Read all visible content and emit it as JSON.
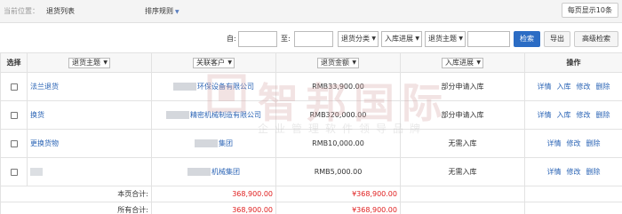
{
  "topbar": {
    "location_label": "当前位置：",
    "location_value": "退货列表",
    "sort_label": "排序规则",
    "page_size": "每页显示10条"
  },
  "filter": {
    "from_label": "自:",
    "to_label": "至:",
    "select_category": "退货分类",
    "select_stock": "入库进展",
    "select_subject": "退货主题",
    "search_button": "检索",
    "export_button": "导出",
    "advanced_button": "高级检索"
  },
  "table": {
    "headers": {
      "select": "选择",
      "subject": "退货主题",
      "customer": "关联客户",
      "amount": "退货金额",
      "stock": "入库进展",
      "ops": "操作"
    },
    "rows": [
      {
        "subject": "法兰退货",
        "customer": "环保设备有限公司",
        "amount": "RMB33,900.00",
        "stock": "部分申请入库",
        "ops": [
          "详情",
          "入库",
          "修改",
          "删除"
        ]
      },
      {
        "subject": "换货",
        "customer": "精密机械制造有限公司",
        "amount": "RMB320,000.00",
        "stock": "部分申请入库",
        "ops": [
          "详情",
          "入库",
          "修改",
          "删除"
        ]
      },
      {
        "subject": "更换货物",
        "customer": "集团",
        "amount": "RMB10,000.00",
        "stock": "无需入库",
        "ops": [
          "详情",
          "修改",
          "删除"
        ]
      },
      {
        "subject": "",
        "customer": "机械集团",
        "amount": "RMB5,000.00",
        "stock": "无需入库",
        "ops": [
          "详情",
          "修改",
          "删除"
        ]
      }
    ],
    "page_total_label": "本页合计:",
    "page_total_a": "368,900.00",
    "page_total_b": "¥368,900.00",
    "all_total_label": "所有合计:",
    "all_total_a": "368,900.00",
    "all_total_b": "¥368,900.00"
  },
  "watermark": {
    "title": "智邦国际",
    "subtitle": "企业管理软件领导品牌"
  },
  "colors": {
    "link": "#2b64b5",
    "primary_button": "#2b6cc4",
    "total_red": "#e02020"
  }
}
